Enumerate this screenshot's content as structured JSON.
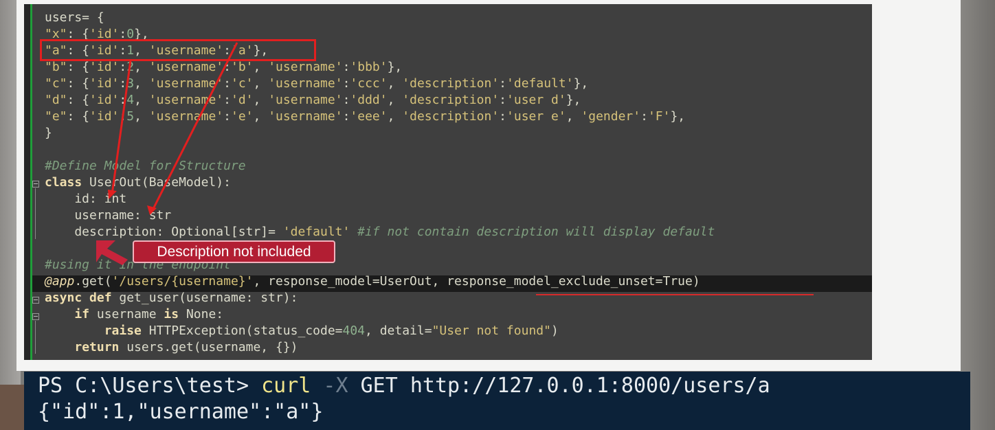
{
  "code": {
    "l1": "users= {",
    "l2_key": "\"x\"",
    "l2_rest1": ": {",
    "l2_s1": "'id'",
    "l2_colon": ":",
    "l2_n": "0",
    "l2_end": "},",
    "l3_key": "\"a\"",
    "l3_s1": "'id'",
    "l3_n": "1",
    "l3_s2": "'username'",
    "l3_s3": "'a'",
    "l4_key": "\"b\"",
    "l4_s1": "'id'",
    "l4_n": "2",
    "l4_s2": "'username'",
    "l4_s3": "'b'",
    "l4_s4": "'username'",
    "l4_s5": "'bbb'",
    "l5_key": "\"c\"",
    "l5_s1": "'id'",
    "l5_n": "3",
    "l5_s2": "'username'",
    "l5_s3": "'c'",
    "l5_s4": "'username'",
    "l5_s5": "'ccc'",
    "l5_s6": "'description'",
    "l5_s7": "'default'",
    "l6_key": "\"d\"",
    "l6_s1": "'id'",
    "l6_n": "4",
    "l6_s2": "'username'",
    "l6_s3": "'d'",
    "l6_s4": "'username'",
    "l6_s5": "'ddd'",
    "l6_s6": "'description'",
    "l6_s7": "'user d'",
    "l7_key": "\"e\"",
    "l7_s1": "'id'",
    "l7_n": "5",
    "l7_s2": "'username'",
    "l7_s3": "'e'",
    "l7_s4": "'username'",
    "l7_s5": "'eee'",
    "l7_s6": "'description'",
    "l7_s7": "'user e'",
    "l7_s8": "'gender'",
    "l7_s9": "'F'",
    "l8": "}",
    "l10": "#Define Model for Structure",
    "l11_kw": "class",
    "l11_rest": " UserOut(BaseModel):",
    "l12": "    id: int",
    "l13": "    username: str",
    "l14_a": "    description: Optional[str]= ",
    "l14_s": "'default'",
    "l14_c": " #if not contain description will display default",
    "l15": "#using it in the endpoint",
    "l16_dec": "@app",
    "l16_a": ".get(",
    "l16_s": "'/users/{username}'",
    "l16_b": ", response_model=UserOut, response_model_exclude_unset=True)",
    "l17_kw": "async def",
    "l17_rest": " get_user(username: str):",
    "l18_a": "    ",
    "l18_kw1": "if",
    "l18_b": " username ",
    "l18_kw2": "is",
    "l18_c": " None:",
    "l19_a": "        ",
    "l19_kw": "raise",
    "l19_b": " HTTPException(status_code=",
    "l19_n": "404",
    "l19_c": ", detail=",
    "l19_s": "\"User not found\"",
    "l19_d": ")",
    "l20_a": "    ",
    "l20_kw": "return",
    "l20_b": " users.get(username, {})"
  },
  "annotation": {
    "callout_text": "Description not included",
    "colors": {
      "highlight": "#e21f1f",
      "callout_bg": "#b21e33"
    }
  },
  "terminal": {
    "prompt": "PS C:\\Users\\test> ",
    "cmd": "curl",
    "flag": " -X",
    "args": " GET http://127.0.0.1:8000/users/a",
    "output": "{\"id\":1,\"username\":\"a\"}"
  }
}
